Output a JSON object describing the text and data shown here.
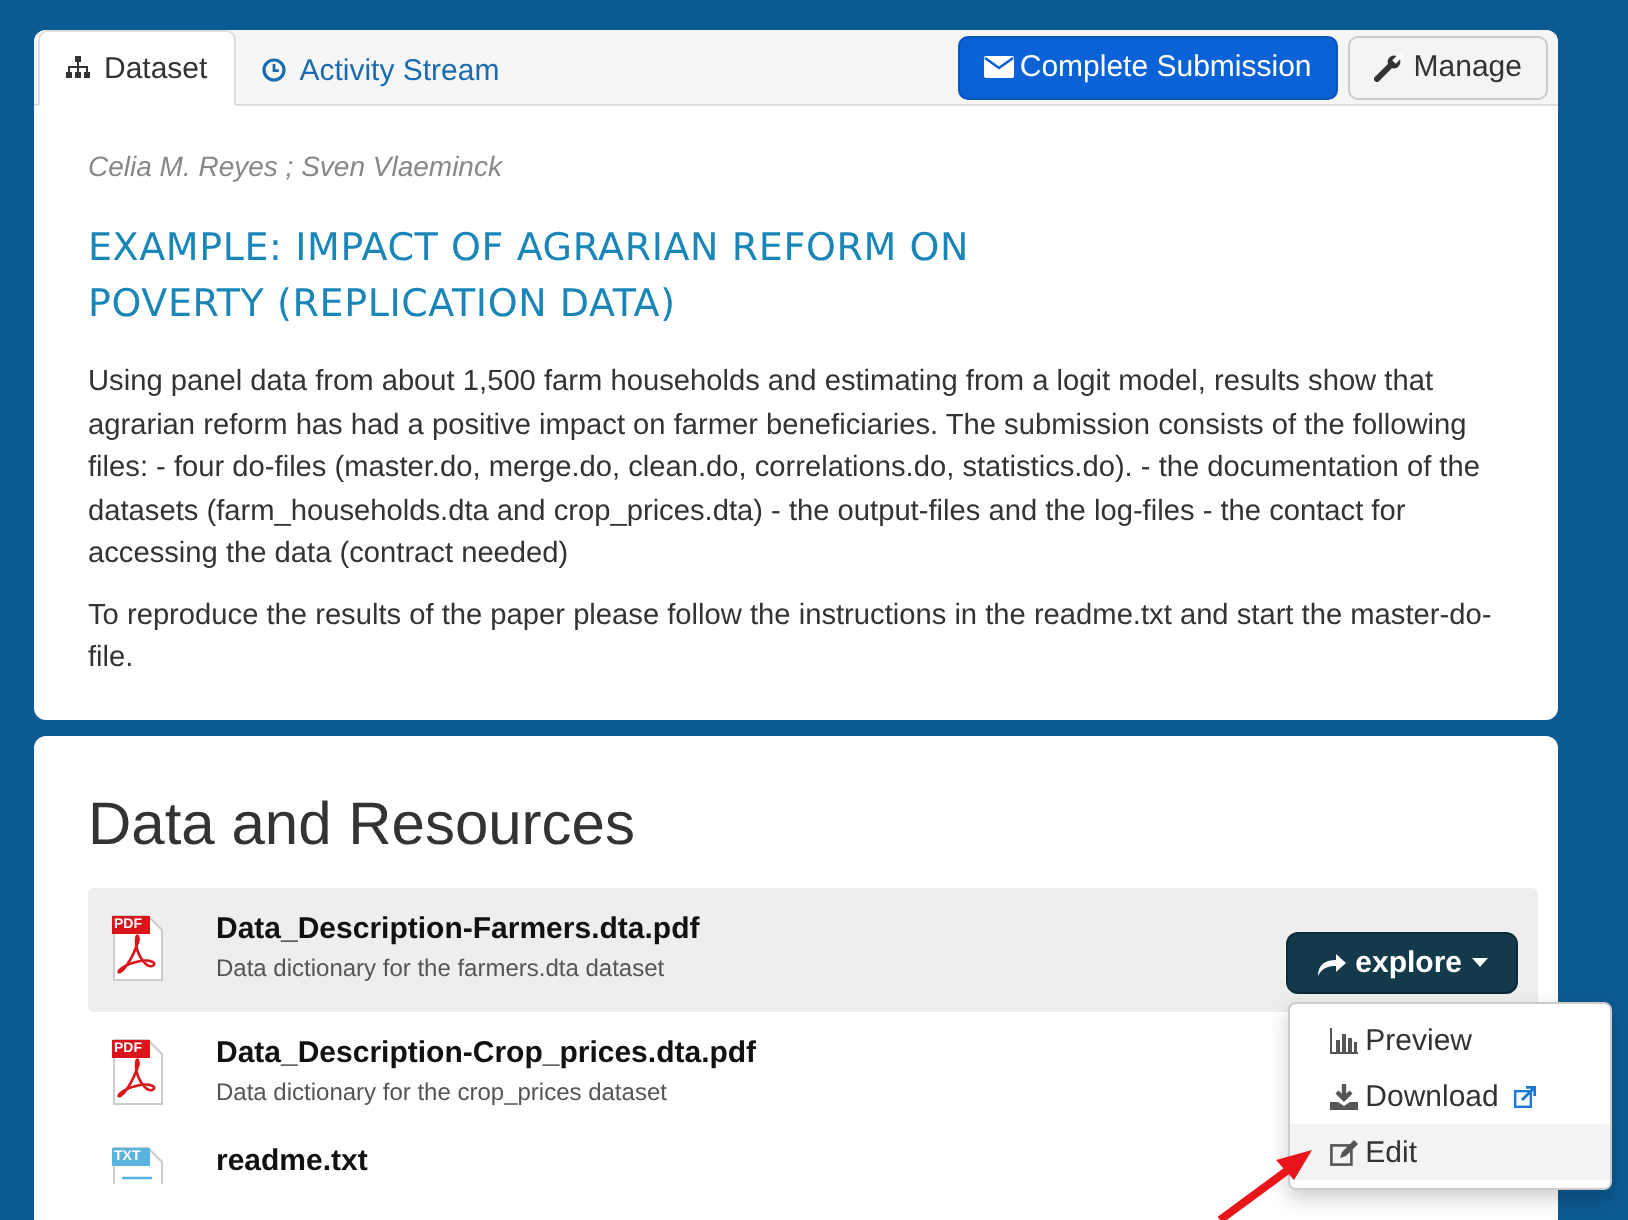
{
  "tabs": [
    {
      "label": "Dataset",
      "selected": true
    },
    {
      "label": "Activity Stream",
      "selected": false
    }
  ],
  "actions": [
    {
      "label": "Complete Submission",
      "kind": "primary"
    },
    {
      "label": "Manage",
      "kind": "default"
    }
  ],
  "authors": "Celia M. Reyes ; Sven Vlaeminck",
  "title": "EXAMPLE: IMPACT OF AGRARIAN REFORM ON POVERTY (REPLICATION DATA)",
  "description": [
    "Using panel data from about 1,500 farm households and estimating from a logit model, results show that agrarian reform has had a positive impact on farmer beneficiaries. The submission consists of the following files: - four do-files (master.do, merge.do, clean.do, correlations.do, statistics.do). - the documentation of the datasets (farm_households.dta and crop_prices.dta) - the output-files and the log-files - the contact for accessing the data (contract needed)",
    "To reproduce the results of the paper please follow the instructions in the readme.txt and start the master-do-file."
  ],
  "resources": {
    "heading": "Data and Resources",
    "items": [
      {
        "format": "PDF",
        "name": "Data_Description-Farmers.dta.pdf",
        "description": "Data dictionary for the farmers.dta dataset",
        "highlighted": true,
        "button": {
          "label": "explore",
          "active": true,
          "menu": [
            {
              "label": "Preview",
              "kind": "preview",
              "selected": false
            },
            {
              "label": "Download",
              "kind": "download",
              "selected": false
            },
            {
              "label": "Edit",
              "kind": "edit",
              "selected": true
            }
          ]
        }
      },
      {
        "format": "PDF",
        "name": "Data_Description-Crop_prices.dta.pdf",
        "description": "Data dictionary for the crop_prices dataset",
        "highlighted": false
      },
      {
        "format": "TXT",
        "name": "readme.txt",
        "highlighted": false
      }
    ]
  }
}
